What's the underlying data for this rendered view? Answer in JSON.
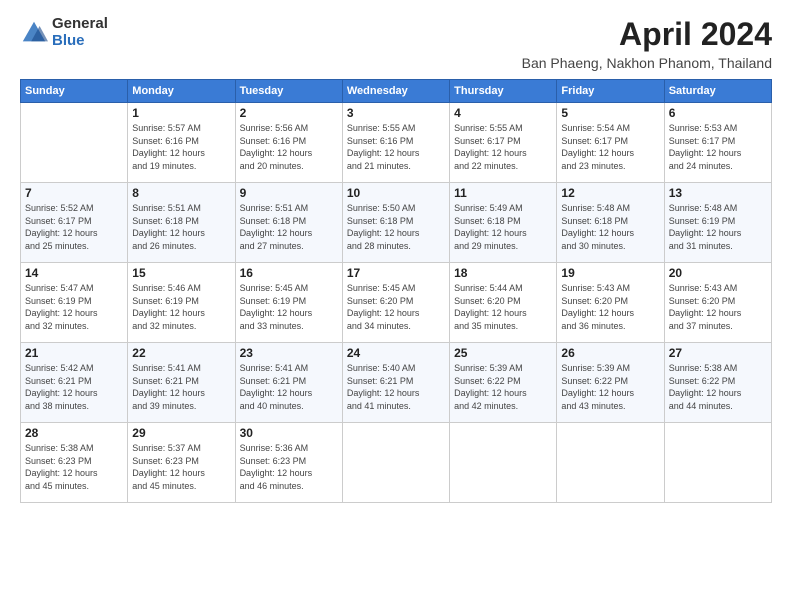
{
  "header": {
    "logo_general": "General",
    "logo_blue": "Blue",
    "title": "April 2024",
    "location": "Ban Phaeng, Nakhon Phanom, Thailand"
  },
  "days_of_week": [
    "Sunday",
    "Monday",
    "Tuesday",
    "Wednesday",
    "Thursday",
    "Friday",
    "Saturday"
  ],
  "weeks": [
    [
      {
        "num": "",
        "info": ""
      },
      {
        "num": "1",
        "info": "Sunrise: 5:57 AM\nSunset: 6:16 PM\nDaylight: 12 hours\nand 19 minutes."
      },
      {
        "num": "2",
        "info": "Sunrise: 5:56 AM\nSunset: 6:16 PM\nDaylight: 12 hours\nand 20 minutes."
      },
      {
        "num": "3",
        "info": "Sunrise: 5:55 AM\nSunset: 6:16 PM\nDaylight: 12 hours\nand 21 minutes."
      },
      {
        "num": "4",
        "info": "Sunrise: 5:55 AM\nSunset: 6:17 PM\nDaylight: 12 hours\nand 22 minutes."
      },
      {
        "num": "5",
        "info": "Sunrise: 5:54 AM\nSunset: 6:17 PM\nDaylight: 12 hours\nand 23 minutes."
      },
      {
        "num": "6",
        "info": "Sunrise: 5:53 AM\nSunset: 6:17 PM\nDaylight: 12 hours\nand 24 minutes."
      }
    ],
    [
      {
        "num": "7",
        "info": "Sunrise: 5:52 AM\nSunset: 6:17 PM\nDaylight: 12 hours\nand 25 minutes."
      },
      {
        "num": "8",
        "info": "Sunrise: 5:51 AM\nSunset: 6:18 PM\nDaylight: 12 hours\nand 26 minutes."
      },
      {
        "num": "9",
        "info": "Sunrise: 5:51 AM\nSunset: 6:18 PM\nDaylight: 12 hours\nand 27 minutes."
      },
      {
        "num": "10",
        "info": "Sunrise: 5:50 AM\nSunset: 6:18 PM\nDaylight: 12 hours\nand 28 minutes."
      },
      {
        "num": "11",
        "info": "Sunrise: 5:49 AM\nSunset: 6:18 PM\nDaylight: 12 hours\nand 29 minutes."
      },
      {
        "num": "12",
        "info": "Sunrise: 5:48 AM\nSunset: 6:18 PM\nDaylight: 12 hours\nand 30 minutes."
      },
      {
        "num": "13",
        "info": "Sunrise: 5:48 AM\nSunset: 6:19 PM\nDaylight: 12 hours\nand 31 minutes."
      }
    ],
    [
      {
        "num": "14",
        "info": "Sunrise: 5:47 AM\nSunset: 6:19 PM\nDaylight: 12 hours\nand 32 minutes."
      },
      {
        "num": "15",
        "info": "Sunrise: 5:46 AM\nSunset: 6:19 PM\nDaylight: 12 hours\nand 32 minutes."
      },
      {
        "num": "16",
        "info": "Sunrise: 5:45 AM\nSunset: 6:19 PM\nDaylight: 12 hours\nand 33 minutes."
      },
      {
        "num": "17",
        "info": "Sunrise: 5:45 AM\nSunset: 6:20 PM\nDaylight: 12 hours\nand 34 minutes."
      },
      {
        "num": "18",
        "info": "Sunrise: 5:44 AM\nSunset: 6:20 PM\nDaylight: 12 hours\nand 35 minutes."
      },
      {
        "num": "19",
        "info": "Sunrise: 5:43 AM\nSunset: 6:20 PM\nDaylight: 12 hours\nand 36 minutes."
      },
      {
        "num": "20",
        "info": "Sunrise: 5:43 AM\nSunset: 6:20 PM\nDaylight: 12 hours\nand 37 minutes."
      }
    ],
    [
      {
        "num": "21",
        "info": "Sunrise: 5:42 AM\nSunset: 6:21 PM\nDaylight: 12 hours\nand 38 minutes."
      },
      {
        "num": "22",
        "info": "Sunrise: 5:41 AM\nSunset: 6:21 PM\nDaylight: 12 hours\nand 39 minutes."
      },
      {
        "num": "23",
        "info": "Sunrise: 5:41 AM\nSunset: 6:21 PM\nDaylight: 12 hours\nand 40 minutes."
      },
      {
        "num": "24",
        "info": "Sunrise: 5:40 AM\nSunset: 6:21 PM\nDaylight: 12 hours\nand 41 minutes."
      },
      {
        "num": "25",
        "info": "Sunrise: 5:39 AM\nSunset: 6:22 PM\nDaylight: 12 hours\nand 42 minutes."
      },
      {
        "num": "26",
        "info": "Sunrise: 5:39 AM\nSunset: 6:22 PM\nDaylight: 12 hours\nand 43 minutes."
      },
      {
        "num": "27",
        "info": "Sunrise: 5:38 AM\nSunset: 6:22 PM\nDaylight: 12 hours\nand 44 minutes."
      }
    ],
    [
      {
        "num": "28",
        "info": "Sunrise: 5:38 AM\nSunset: 6:23 PM\nDaylight: 12 hours\nand 45 minutes."
      },
      {
        "num": "29",
        "info": "Sunrise: 5:37 AM\nSunset: 6:23 PM\nDaylight: 12 hours\nand 45 minutes."
      },
      {
        "num": "30",
        "info": "Sunrise: 5:36 AM\nSunset: 6:23 PM\nDaylight: 12 hours\nand 46 minutes."
      },
      {
        "num": "",
        "info": ""
      },
      {
        "num": "",
        "info": ""
      },
      {
        "num": "",
        "info": ""
      },
      {
        "num": "",
        "info": ""
      }
    ]
  ]
}
